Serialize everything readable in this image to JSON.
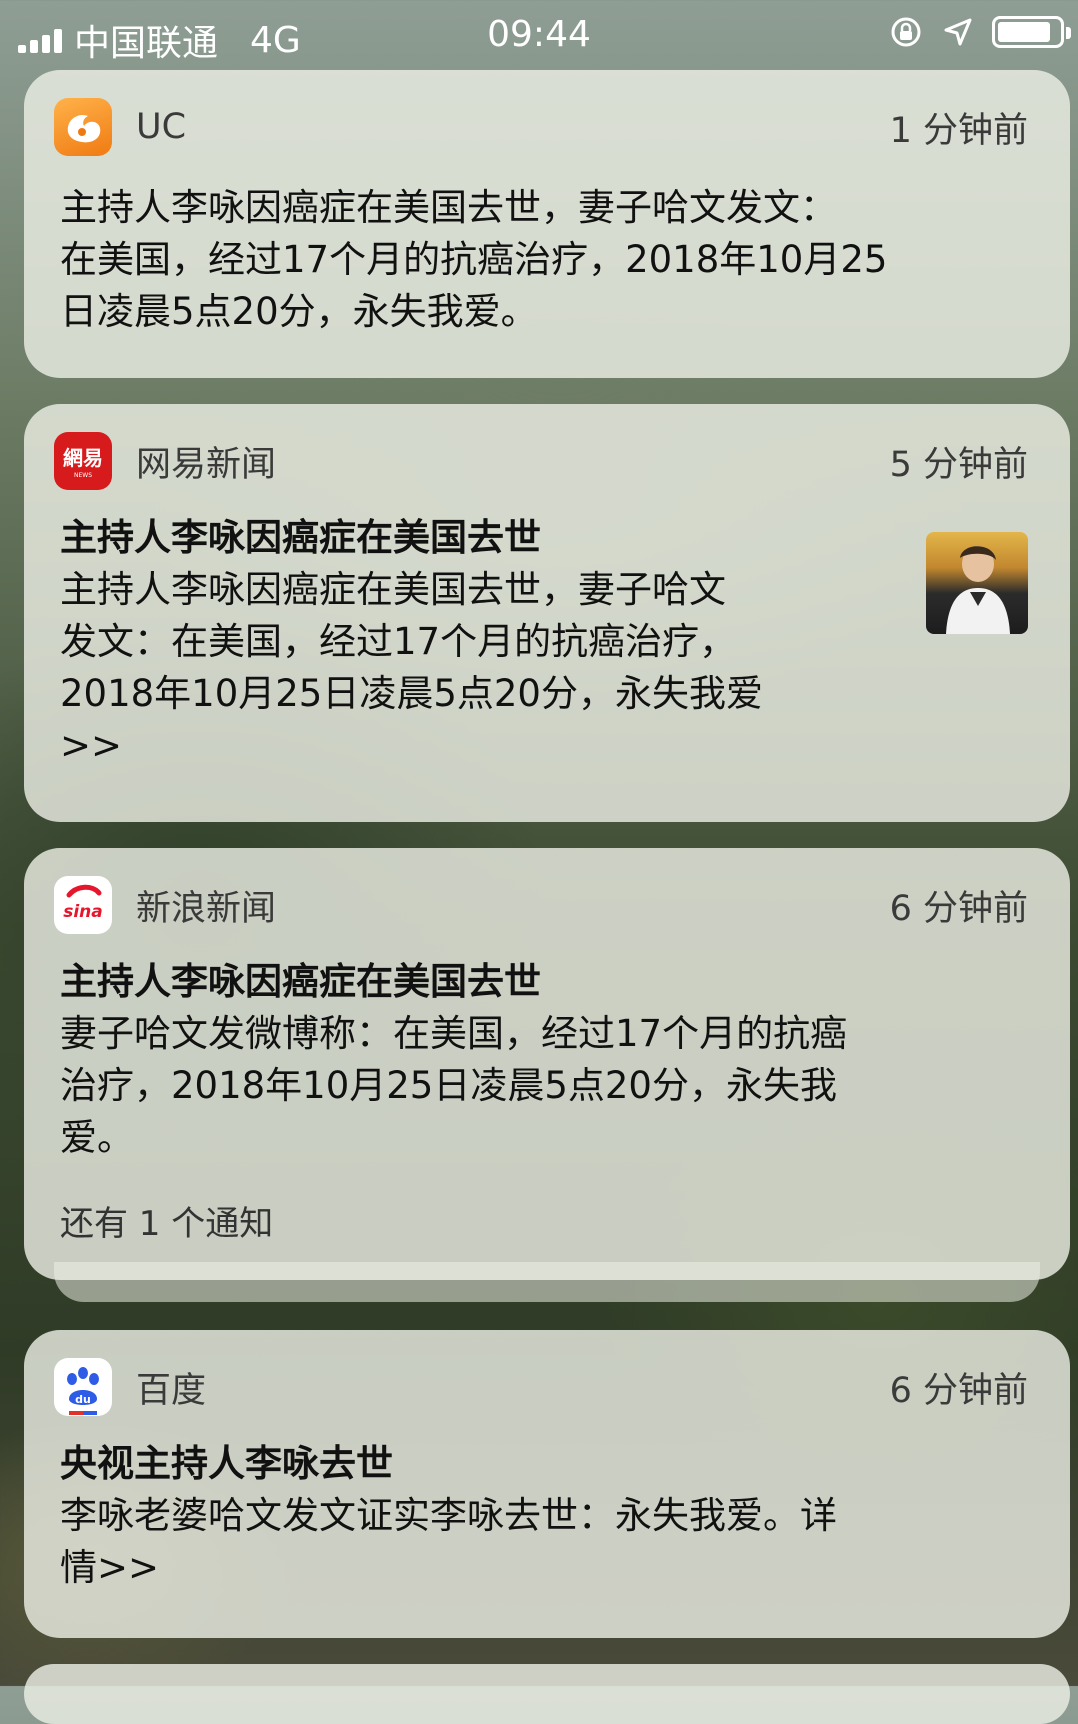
{
  "status_bar": {
    "carrier": "中国联通",
    "network": "4G",
    "time": "09:44"
  },
  "notifications": [
    {
      "app": "UC",
      "time": "1 分钟前",
      "lines": [
        "主持人李咏因癌症在美国去世，妻子哈文发文：",
        "在美国，经过17个月的抗癌治疗，2018年10月25",
        "日凌晨5点20分，永失我爱。"
      ]
    },
    {
      "app": "网易新闻",
      "time": "5 分钟前",
      "title": "主持人李咏因癌症在美国去世",
      "lines": [
        "主持人李咏因癌症在美国去世，妻子哈文",
        "发文：在美国，经过17个月的抗癌治疗，",
        "2018年10月25日凌晨5点20分，永失我爱",
        ">>"
      ]
    },
    {
      "app": "新浪新闻",
      "time": "6 分钟前",
      "title": "主持人李咏因癌症在美国去世",
      "lines": [
        "妻子哈文发微博称：在美国，经过17个月的抗癌",
        "治疗，2018年10月25日凌晨5点20分，永失我",
        "爱。"
      ],
      "more": "还有 1 个通知"
    },
    {
      "app": "百度",
      "time": "6 分钟前",
      "title": "央视主持人李咏去世",
      "lines": [
        "李咏老婆哈文发文证实李咏去世：永失我爱。详",
        "情>>"
      ]
    }
  ],
  "icons": {
    "uc": "uc-squirrel-icon",
    "netease": "netease-news-icon",
    "sina": "sina-eye-icon",
    "baidu": "baidu-paw-icon"
  }
}
